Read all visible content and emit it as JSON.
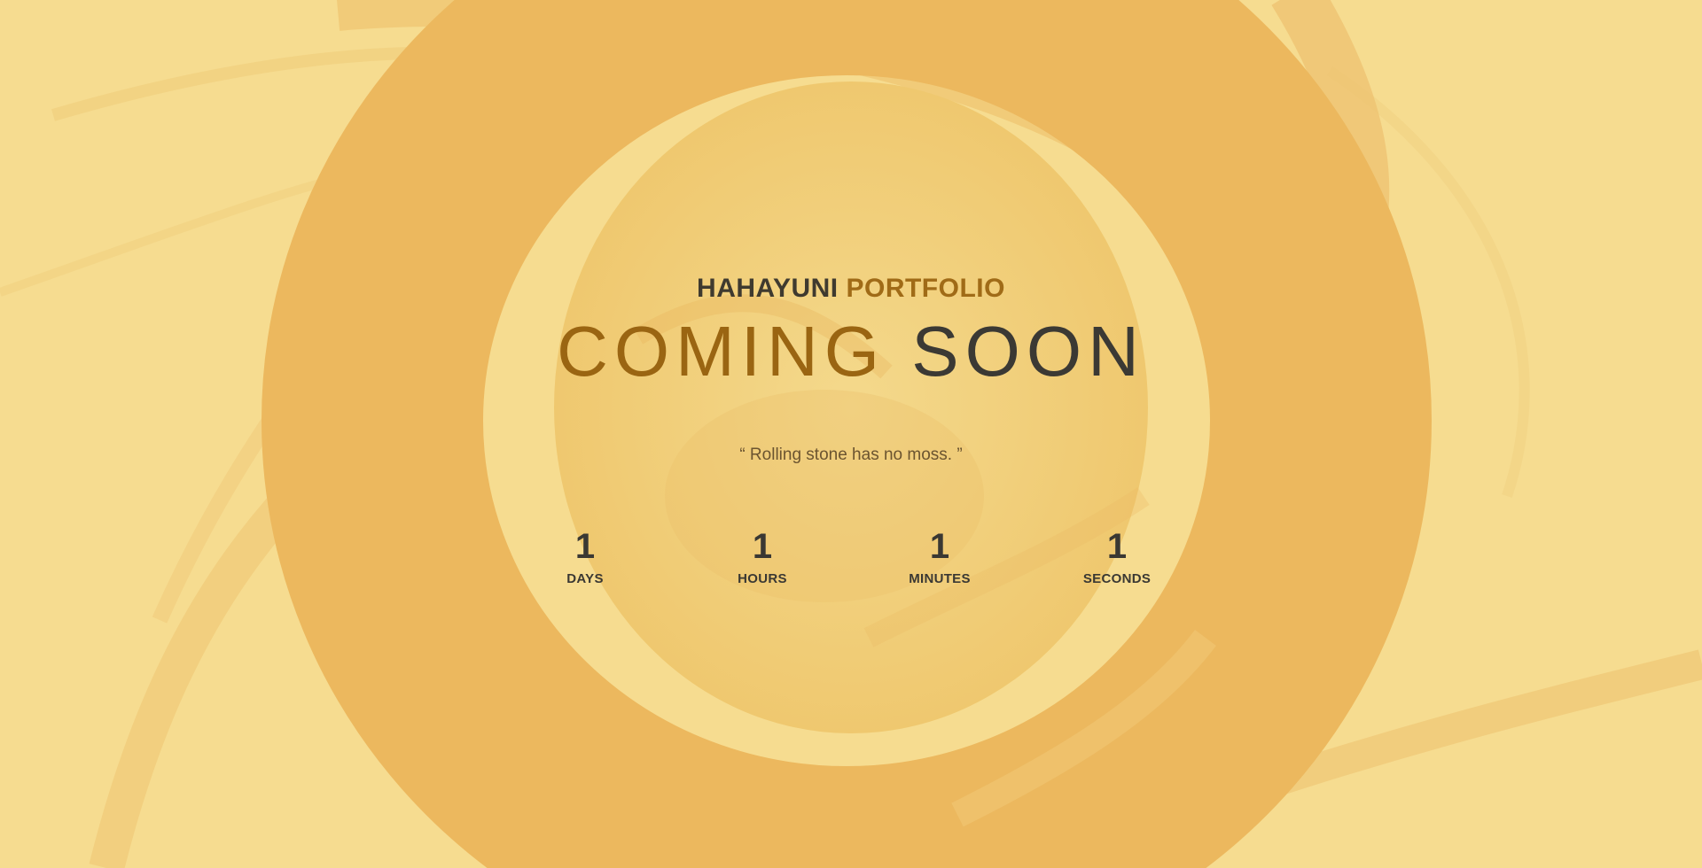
{
  "brand": {
    "part1": "HAHAYUNI",
    "part2": "PORTFOLIO"
  },
  "headline": {
    "part1": "COMING",
    "part2": "SOON"
  },
  "quote": "“ Rolling stone has no moss. ”",
  "countdown": [
    {
      "value": "1",
      "label": "DAYS"
    },
    {
      "value": "1",
      "label": "HOURS"
    },
    {
      "value": "1",
      "label": "MINUTES"
    },
    {
      "value": "1",
      "label": "SECONDS"
    }
  ],
  "colors": {
    "background": "#f6dc90",
    "ring": "#ebb65c",
    "accent": "#a06b17",
    "dark": "#3b3934"
  }
}
